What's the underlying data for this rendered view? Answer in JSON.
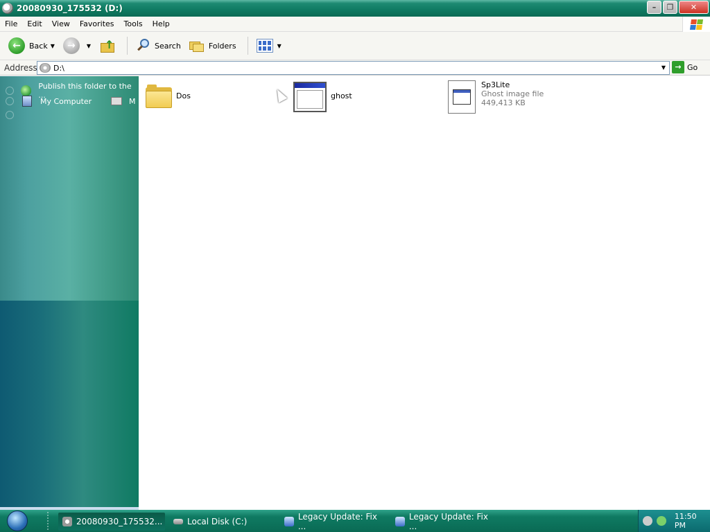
{
  "window": {
    "title": "20080930_175532 (D:)",
    "minimize": "–",
    "restore": "❐",
    "close": "✕"
  },
  "menu": [
    "File",
    "Edit",
    "View",
    "Favorites",
    "Tools",
    "Help"
  ],
  "toolbar": {
    "back_label": "Back",
    "search_label": "Search",
    "folders_label": "Folders"
  },
  "address": {
    "label": "Address",
    "value": "D:\\",
    "go_label": "Go"
  },
  "taskpane": {
    "items": [
      {
        "label": "Publish this folder to the ..."
      },
      {
        "label": "My Computer"
      }
    ],
    "extra_char": "M"
  },
  "files": [
    {
      "name": "Dos"
    },
    {
      "name": "ghost"
    },
    {
      "name": "Sp3Lite",
      "type": "Ghost image file",
      "size": "449,413 KB"
    }
  ],
  "taskbar": {
    "tasks": [
      {
        "label": "20080930_175532...",
        "active": true
      },
      {
        "label": "Local Disk (C:)"
      },
      {
        "label": "Legacy Update: Fix ..."
      },
      {
        "label": "Legacy Update: Fix ..."
      }
    ],
    "clock": "11:50 PM"
  },
  "colors": {
    "titlebar": "#0f7a62",
    "taskbar": "#0a6a54",
    "folder": "#f1cc52"
  }
}
